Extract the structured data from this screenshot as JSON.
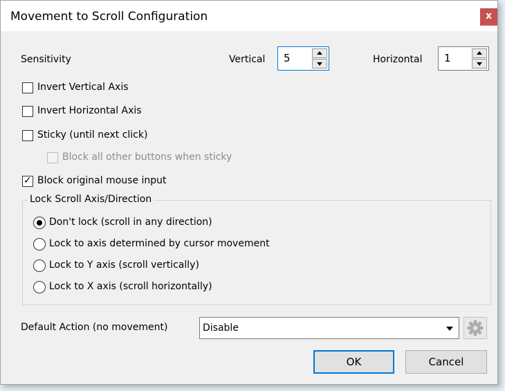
{
  "window": {
    "title": "Movement to Scroll Configuration",
    "close_glyph": "x"
  },
  "sensitivity": {
    "label": "Sensitivity",
    "vertical_label": "Vertical",
    "vertical_value": "5",
    "horizontal_label": "Horizontal",
    "horizontal_value": "1"
  },
  "options": {
    "invert_vertical": {
      "label": "Invert Vertical Axis",
      "checked": false
    },
    "invert_horizontal": {
      "label": "Invert Horizontal Axis",
      "checked": false
    },
    "sticky": {
      "label": "Sticky (until next click)",
      "checked": false
    },
    "block_buttons_sticky": {
      "label": "Block all other buttons when sticky",
      "checked": false,
      "disabled": true
    },
    "block_original": {
      "label": "Block original mouse input",
      "checked": true
    }
  },
  "lock_group": {
    "title": "Lock Scroll Axis/Direction",
    "options": [
      {
        "label": "Don't lock (scroll in any direction)",
        "selected": true
      },
      {
        "label": "Lock to axis determined by cursor movement",
        "selected": false
      },
      {
        "label": "Lock to Y axis (scroll vertically)",
        "selected": false
      },
      {
        "label": "Lock to X axis (scroll horizontally)",
        "selected": false
      }
    ]
  },
  "default_action": {
    "label": "Default Action (no movement)",
    "selected": "Disable",
    "gear_icon": "gear-icon"
  },
  "buttons": {
    "ok": "OK",
    "cancel": "Cancel"
  },
  "colors": {
    "accent": "#0078d7",
    "close_bg": "#c75050",
    "dialog_bg": "#f0f0f0"
  }
}
